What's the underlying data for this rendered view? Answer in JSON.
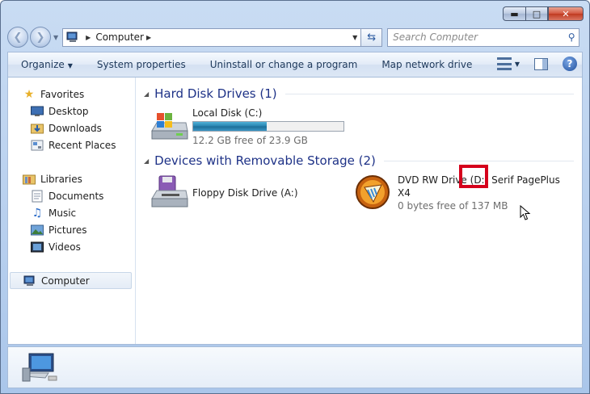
{
  "address": {
    "crumb": "Computer"
  },
  "search": {
    "placeholder": "Search Computer"
  },
  "toolbar": {
    "organize": "Organize",
    "system_properties": "System properties",
    "uninstall": "Uninstall or change a program",
    "map_drive": "Map network drive"
  },
  "sidebar": {
    "favorites": "Favorites",
    "desktop": "Desktop",
    "downloads": "Downloads",
    "recent": "Recent Places",
    "libraries": "Libraries",
    "documents": "Documents",
    "music": "Music",
    "pictures": "Pictures",
    "videos": "Videos",
    "computer": "Computer"
  },
  "groups": {
    "hdd": "Hard Disk Drives (1)",
    "removable": "Devices with Removable Storage (2)"
  },
  "drives": {
    "local": {
      "name": "Local Disk (C:)",
      "free": "12.2 GB free of 23.9 GB",
      "used_fraction": 0.49
    },
    "floppy": {
      "name": "Floppy Disk Drive (A:)"
    },
    "dvd": {
      "name_line1": "DVD RW Drive (D:) Serif PagePlus",
      "name_line2": "X4",
      "free": "0 bytes free of 137 MB"
    }
  },
  "colors": {
    "accent": "#1e3287",
    "highlight": "#d5001c"
  }
}
